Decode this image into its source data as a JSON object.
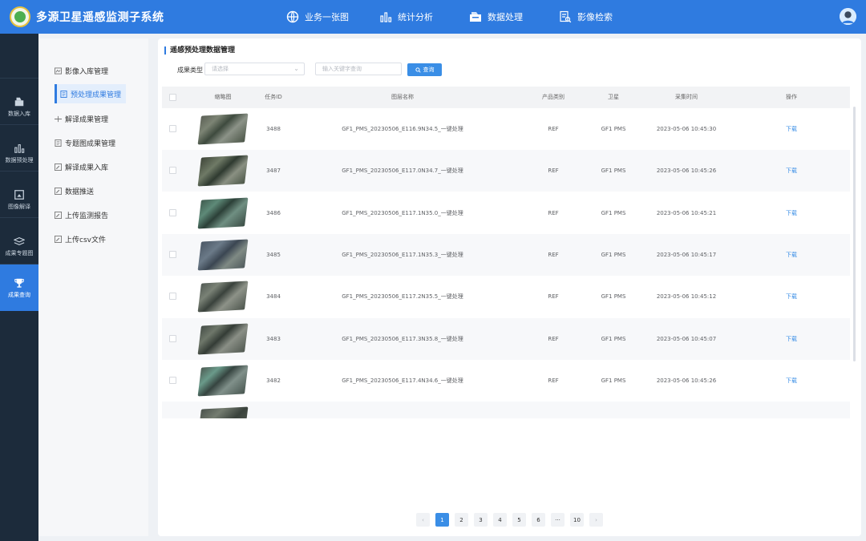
{
  "header": {
    "title": "多源卫星遥感监测子系统",
    "nav": [
      {
        "label": "业务一张图",
        "icon": "globe-icon"
      },
      {
        "label": "统计分析",
        "icon": "bar-chart-icon"
      },
      {
        "label": "数据处理",
        "icon": "data-process-icon"
      },
      {
        "label": "影像检索",
        "icon": "document-search-icon"
      }
    ],
    "user_icon": "user-avatar-icon"
  },
  "leftbar": {
    "items": [
      {
        "label": "数据入库",
        "icon": "database-icon"
      },
      {
        "label": "数据预处理",
        "icon": "bar-chart-icon"
      },
      {
        "label": "图像解译",
        "icon": "image-frame-icon"
      },
      {
        "label": "成果专题图",
        "icon": "map-layers-icon"
      },
      {
        "label": "成果查询",
        "icon": "trophy-icon",
        "active": true
      }
    ]
  },
  "subnav": {
    "items": [
      {
        "label": "影像入库管理",
        "icon": "image-icon"
      },
      {
        "label": "预处理成果管理",
        "icon": "document-icon",
        "active": true
      },
      {
        "label": "解译成果管理",
        "icon": "split-icon"
      },
      {
        "label": "专题图成果管理",
        "icon": "document-icon"
      },
      {
        "label": "解译成果入库",
        "icon": "edit-icon"
      },
      {
        "label": "数据推送",
        "icon": "edit-icon"
      },
      {
        "label": "上传监测报告",
        "icon": "edit-icon"
      },
      {
        "label": "上传csv文件",
        "icon": "edit-icon"
      }
    ]
  },
  "main": {
    "section_title": "遥感预处理数据管理",
    "filter": {
      "label": "成果类型",
      "select_placeholder": "请选择",
      "search_placeholder": "输入关键字查询",
      "query_label": "查询"
    },
    "table": {
      "headers": [
        "缩略图",
        "任务ID",
        "图层名称",
        "产品类别",
        "卫星",
        "采集时间",
        "操作"
      ],
      "rows": [
        {
          "id": "3488",
          "name": "GF1_PMS_20230506_E116.9N34.5_一键处理",
          "category": "REF",
          "satellite": "GF1 PMS",
          "time": "2023-05-06 10:45:30",
          "action": "下载"
        },
        {
          "id": "3487",
          "name": "GF1_PMS_20230506_E117.0N34.7_一键处理",
          "category": "REF",
          "satellite": "GF1 PMS",
          "time": "2023-05-06 10:45:26",
          "action": "下载"
        },
        {
          "id": "3486",
          "name": "GF1_PMS_20230506_E117.1N35.0_一键处理",
          "category": "REF",
          "satellite": "GF1 PMS",
          "time": "2023-05-06 10:45:21",
          "action": "下载"
        },
        {
          "id": "3485",
          "name": "GF1_PMS_20230506_E117.1N35.3_一键处理",
          "category": "REF",
          "satellite": "GF1 PMS",
          "time": "2023-05-06 10:45:17",
          "action": "下载"
        },
        {
          "id": "3484",
          "name": "GF1_PMS_20230506_E117.2N35.5_一键处理",
          "category": "REF",
          "satellite": "GF1 PMS",
          "time": "2023-05-06 10:45:12",
          "action": "下载"
        },
        {
          "id": "3483",
          "name": "GF1_PMS_20230506_E117.3N35.8_一键处理",
          "category": "REF",
          "satellite": "GF1 PMS",
          "time": "2023-05-06 10:45:07",
          "action": "下载"
        },
        {
          "id": "3482",
          "name": "GF1_PMS_20230506_E117.4N34.6_一键处理",
          "category": "REF",
          "satellite": "GF1 PMS",
          "time": "2023-05-06 10:45:26",
          "action": "下载"
        }
      ]
    },
    "pagination": {
      "prev": "‹",
      "pages": [
        "1",
        "2",
        "3",
        "4",
        "5",
        "6",
        "···",
        "10"
      ],
      "current": "1",
      "next": "›"
    }
  },
  "colors": {
    "header_bg": "#2f7be0",
    "leftbar_bg": "#1c2b3b",
    "accent": "#3a8ee6"
  }
}
